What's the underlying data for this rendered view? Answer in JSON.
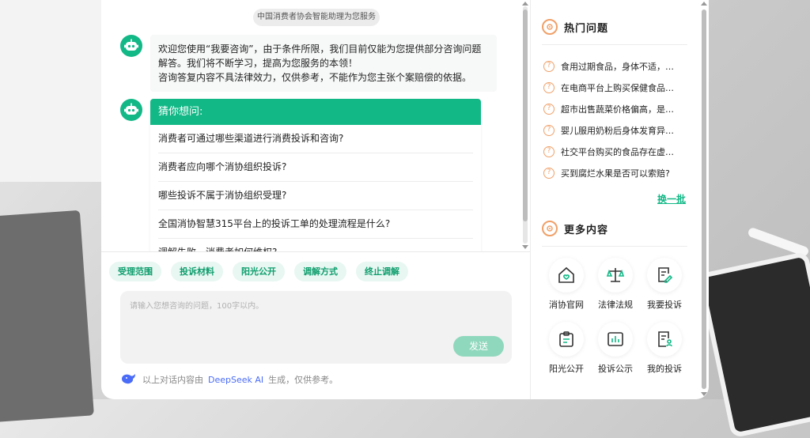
{
  "header": {
    "title": "中国消费者协会智能助理为您服务"
  },
  "welcome": {
    "lines": [
      "欢迎您使用“我要咨询”，由于条件所限，我们目前仅能为您提供部分咨询问题解答。我们将不断学习，提高为您服务的本领！",
      "咨询答复内容不具法律效力，仅供参考，不能作为您主张个案赔偿的依据。"
    ]
  },
  "guess": {
    "title": "猜你想问:",
    "items": [
      "消费者可通过哪些渠道进行消费投诉和咨询?",
      "消费者应向哪个消协组织投诉?",
      "哪些投诉不属于消协组织受理?",
      "全国消协智慧315平台上的投诉工单的处理流程是什么?",
      "调解失败，消费者如何维权?"
    ]
  },
  "chips": [
    "受理范围",
    "投诉材料",
    "阳光公开",
    "调解方式",
    "终止调解"
  ],
  "input": {
    "placeholder": "请输入您想咨询的问题，100字以内。",
    "value": ""
  },
  "send_label": "发送",
  "footer": {
    "prefix": "以上对话内容由",
    "brand": "DeepSeek AI",
    "suffix": "生成，仅供参考。"
  },
  "hot": {
    "title": "热门问题",
    "items": [
      "食用过期食品，身体不适，…",
      "在电商平台上购买保健食品…",
      "超市出售蔬菜价格偏高，是…",
      "婴儿服用奶粉后身体发育异…",
      "社交平台购买的食品存在虚…",
      "买到腐烂水果是否可以索赔?"
    ],
    "refresh_label": "换一批"
  },
  "more": {
    "title": "更多内容",
    "items": [
      {
        "label": "消协官网",
        "icon": "home-heart-icon"
      },
      {
        "label": "法律法规",
        "icon": "scales-icon"
      },
      {
        "label": "我要投诉",
        "icon": "edit-document-icon"
      },
      {
        "label": "阳光公开",
        "icon": "clipboard-icon"
      },
      {
        "label": "投诉公示",
        "icon": "bar-chart-icon"
      },
      {
        "label": "我的投诉",
        "icon": "user-document-icon"
      }
    ]
  },
  "colors": {
    "accent": "#12b886",
    "chip_bg": "#e8f7f2",
    "orange": "#f0a068",
    "send_btn": "#8fd8bd",
    "link_blue": "#4a6cf7"
  }
}
